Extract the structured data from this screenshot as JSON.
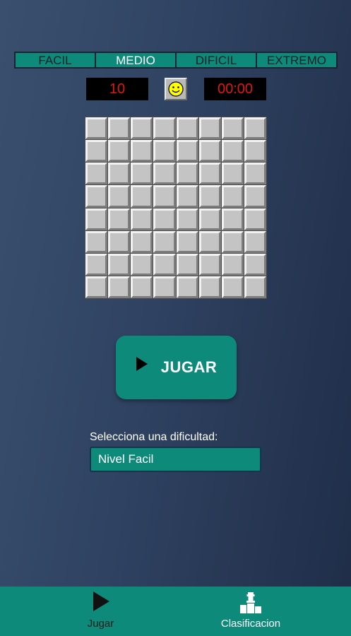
{
  "difficulty_tabs": [
    {
      "label": "FACIL",
      "active": false
    },
    {
      "label": "MEDIO",
      "active": true
    },
    {
      "label": "DIFICIL",
      "active": false
    },
    {
      "label": "EXTREMO",
      "active": false
    }
  ],
  "status": {
    "mines_remaining": "10",
    "timer": "00:00",
    "face_icon": "smiley-face-icon"
  },
  "board": {
    "rows": 8,
    "cols": 8,
    "state": "unrevealed"
  },
  "play_button": {
    "label": "JUGAR",
    "icon": "play-icon"
  },
  "difficulty_select": {
    "label": "Selecciona una dificultad:",
    "value": "Nivel Facil"
  },
  "bottom_nav": {
    "items": [
      {
        "label": "Jugar",
        "icon": "play-icon"
      },
      {
        "label": "Clasificacion",
        "icon": "podium-chess-icon"
      }
    ]
  },
  "colors": {
    "accent": "#0e8a7a",
    "background_start": "#3a4f6e",
    "background_end": "#1f2d48",
    "counter_text": "#e31515"
  }
}
